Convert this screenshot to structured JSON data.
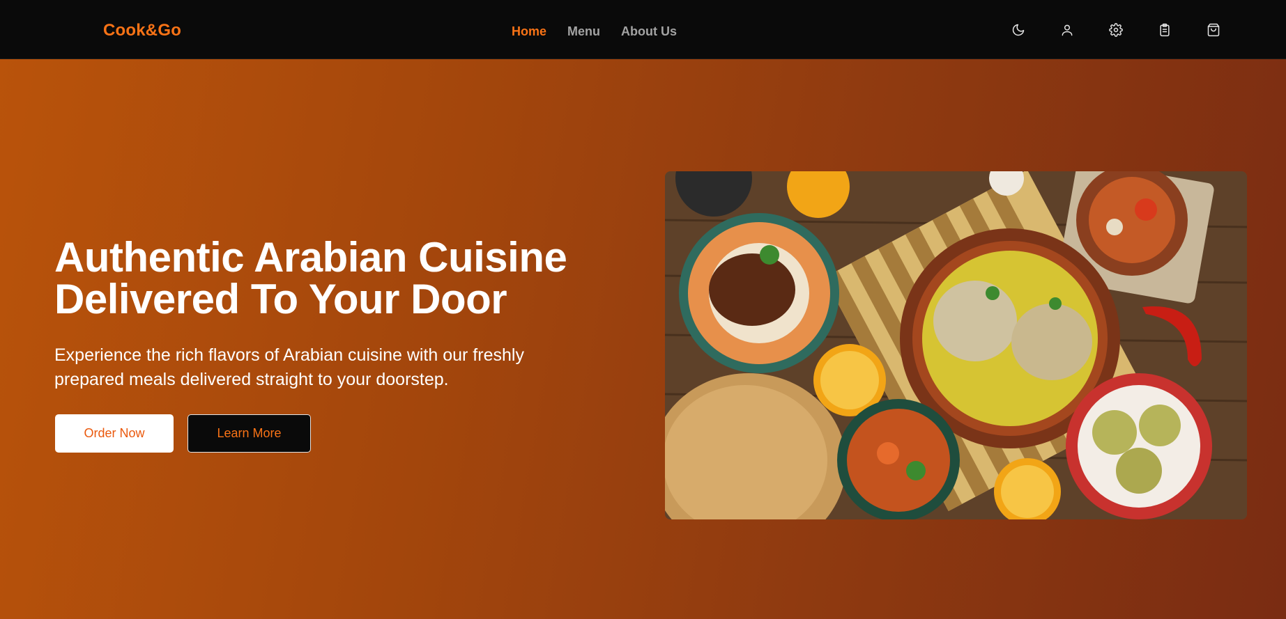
{
  "navbar": {
    "brand": "Cook&Go",
    "links": [
      {
        "label": "Home",
        "active": true
      },
      {
        "label": "Menu",
        "active": false
      },
      {
        "label": "About Us",
        "active": false
      }
    ],
    "icons": [
      "moon-icon",
      "user-icon",
      "settings-icon",
      "clipboard-icon",
      "shopping-bag-icon"
    ]
  },
  "hero": {
    "title_line1": "Authentic Arabian Cuisine",
    "title_line2": "Delivered To Your Door",
    "subtitle": "Experience the rich flavors of Arabian cuisine with our freshly prepared meals delivered straight to your doorstep.",
    "primary_button": "Order Now",
    "secondary_button": "Learn More"
  },
  "colors": {
    "accent": "#f97316",
    "navbar_bg": "#0a0a0a",
    "hero_gradient_start": "#b9530b",
    "hero_gradient_end": "#7a2c12"
  }
}
